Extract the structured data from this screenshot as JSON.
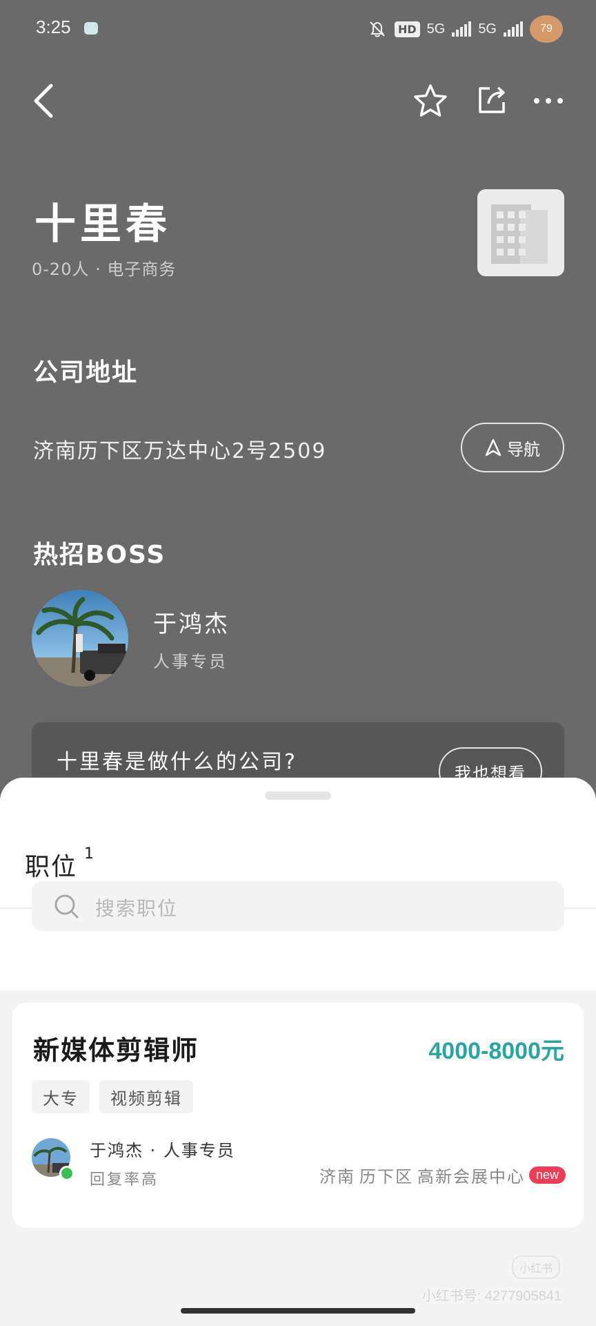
{
  "status_bar": {
    "time": "3:25",
    "hd_label": "HD",
    "network_1": "5G",
    "network_2": "5G",
    "battery": "79"
  },
  "company": {
    "name": "十里春",
    "meta": "0-20人 · 电子商务"
  },
  "address_section": {
    "title": "公司地址",
    "address": "济南历下区万达中心2号2509",
    "navigate_label": "导航"
  },
  "boss_section": {
    "title": "热招BOSS",
    "name": "于鸿杰",
    "role": "人事专员"
  },
  "qa_card": {
    "question": "十里春是做什么的公司?",
    "button_label": "我也想看"
  },
  "jobs_sheet": {
    "title": "职位",
    "count": "1",
    "search_placeholder": "搜索职位",
    "jobs": [
      {
        "title": "新媒体剪辑师",
        "salary": "4000-8000元",
        "tags": [
          "大专",
          "视频剪辑"
        ],
        "recruiter": "于鸿杰 · 人事专员",
        "reply_rate": "回复率高",
        "city": "济南",
        "district": "历下区",
        "area": "高新会展中心",
        "badge": "new"
      }
    ]
  },
  "watermark": {
    "logo": "小红书",
    "id": "小红书号: 4277905841"
  },
  "colors": {
    "background_overlay": "#6a6a6a",
    "salary": "#2aa5a0",
    "new_badge": "#ec3d55",
    "online": "#38c150"
  }
}
